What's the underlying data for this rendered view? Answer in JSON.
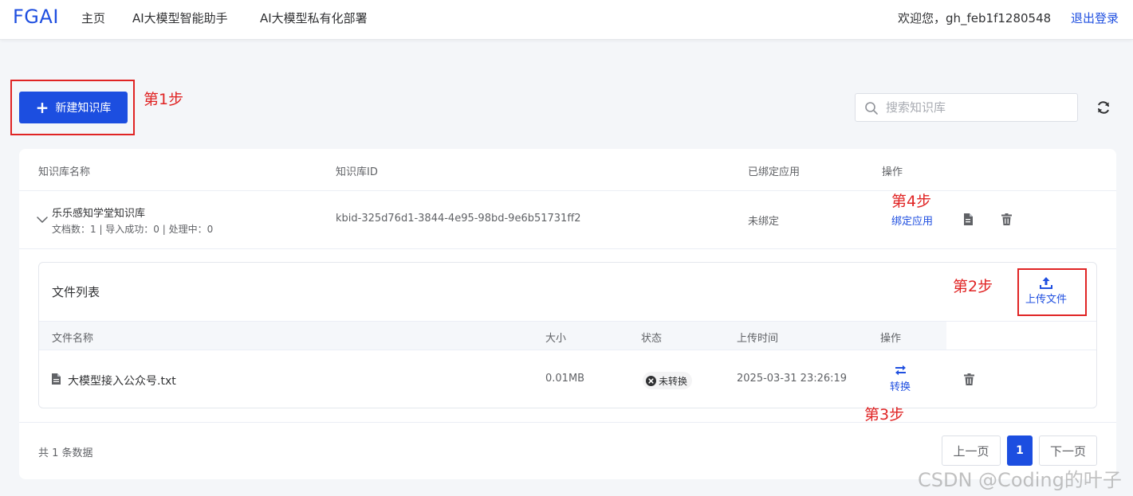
{
  "header": {
    "brand": "FGAI",
    "nav": [
      "主页",
      "AI大模型智能助手",
      "AI大模型私有化部署"
    ],
    "welcome": "欢迎您，gh_feb1f1280548",
    "logout": "退出登录"
  },
  "toolbar": {
    "new_kb_label": "新建知识库",
    "search_placeholder": "搜索知识库"
  },
  "annotations": {
    "step1": "第1步",
    "step2": "第2步",
    "step3": "第3步",
    "step4": "第4步"
  },
  "kb_table": {
    "headers": [
      "知识库名称",
      "知识库ID",
      "已绑定应用",
      "操作"
    ],
    "row": {
      "name": "乐乐感知学堂知识库",
      "stats": "文档数：1 | 导入成功：0 | 处理中：0",
      "id": "kbid-325d76d1-3844-4e95-98bd-9e6b51731ff2",
      "bound": "未绑定",
      "bind_action": "绑定应用"
    }
  },
  "file_list": {
    "title": "文件列表",
    "upload_label": "上传文件",
    "headers": [
      "文件名称",
      "大小",
      "状态",
      "上传时间",
      "操作"
    ],
    "row": {
      "name": "大模型接入公众号.txt",
      "size": "0.01MB",
      "status": "未转换",
      "time": "2025-03-31 23:26:19",
      "convert_label": "转换"
    }
  },
  "pagination": {
    "total": "共 1 条数据",
    "prev": "上一页",
    "current": "1",
    "next": "下一页"
  },
  "watermark": "CSDN @Coding的叶子",
  "colors": {
    "primary": "#1c4ee0",
    "annotation": "#e02424"
  }
}
